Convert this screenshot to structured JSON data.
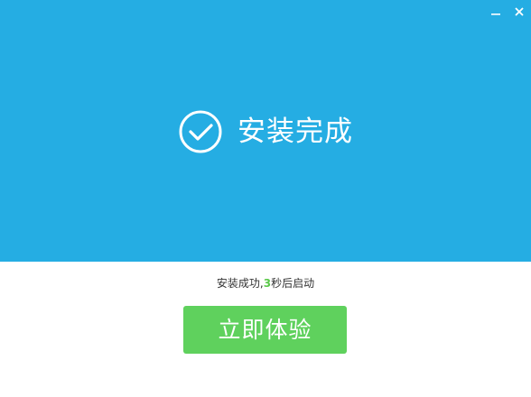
{
  "colors": {
    "hero_bg": "#25ade3",
    "button_bg": "#5fd15d",
    "countdown": "#5bc94a"
  },
  "titlebar": {
    "minimize_icon": "minimize-icon",
    "close_icon": "close-icon"
  },
  "hero": {
    "icon": "check-circle-icon",
    "title": "安装完成"
  },
  "status": {
    "prefix": "安装成功,",
    "countdown": "3",
    "suffix": "秒后启动"
  },
  "action": {
    "label": "立即体验"
  }
}
